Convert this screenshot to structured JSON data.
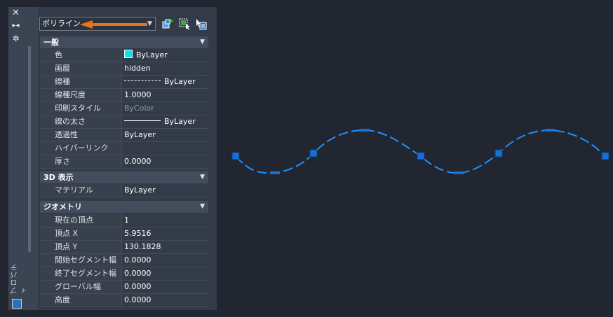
{
  "palette": {
    "title": "プロパティ",
    "object_type": "ポリライン",
    "sections": [
      {
        "title": "一般",
        "rows": [
          {
            "name": "色",
            "value": "ByLayer",
            "swatch_color": "#00e5ee"
          },
          {
            "name": "画層",
            "value": "hidden"
          },
          {
            "name": "線種",
            "value": "ByLayer"
          },
          {
            "name": "線種尺度",
            "value": "1.0000"
          },
          {
            "name": "印刷スタイル",
            "value": "ByColor",
            "dim": true
          },
          {
            "name": "線の太さ",
            "value": "ByLayer"
          },
          {
            "name": "透過性",
            "value": "ByLayer"
          },
          {
            "name": "ハイパーリンク",
            "value": ""
          },
          {
            "name": "厚さ",
            "value": "0.0000"
          }
        ]
      },
      {
        "title": "3D 表示",
        "rows": [
          {
            "name": "マテリアル",
            "value": "ByLayer"
          }
        ]
      },
      {
        "title": "ジオメトリ",
        "rows": [
          {
            "name": "現在の頂点",
            "value": "1"
          },
          {
            "name": "頂点 X",
            "value": "5.9516"
          },
          {
            "name": "頂点 Y",
            "value": "130.1828"
          },
          {
            "name": "開始セグメント幅",
            "value": "0.0000"
          },
          {
            "name": "終了セグメント幅",
            "value": "0.0000"
          },
          {
            "name": "グローバル幅",
            "value": "0.0000"
          },
          {
            "name": "高度",
            "value": "0.0000"
          }
        ]
      }
    ]
  },
  "colors": {
    "canvas_background": "#212630",
    "polyline": "#1e90ff",
    "grip": "#1a6fd6",
    "annotation_arrow": "#e8731a"
  }
}
